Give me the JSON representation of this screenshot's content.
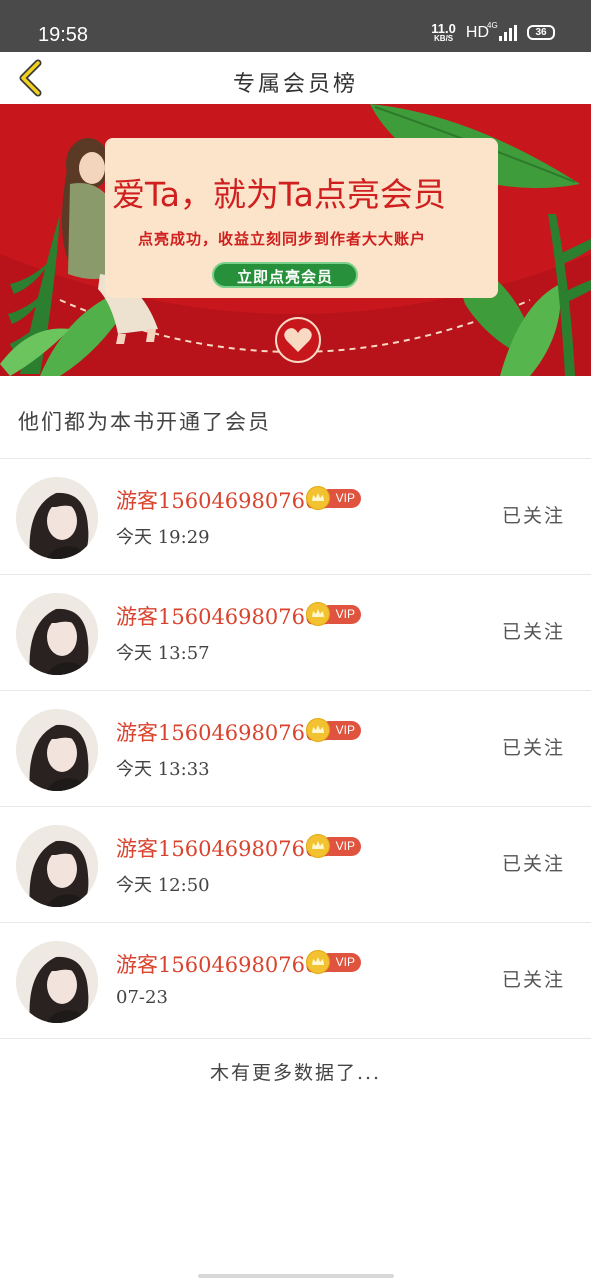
{
  "status_bar": {
    "time": "19:58",
    "net_speed": "11.0",
    "net_unit": "KB/S",
    "hd": "HD",
    "network": "4G",
    "battery": "36"
  },
  "nav": {
    "title": "专属会员榜"
  },
  "banner": {
    "headline": "爱Ta，就为Ta点亮会员",
    "subtitle": "点亮成功，收益立刻同步到作者大大账户",
    "button": "立即点亮会员"
  },
  "section_title": "他们都为本书开通了会员",
  "vip_label": "VIP",
  "members": [
    {
      "name": "游客1560469807668",
      "time": "今天 19:29",
      "status": "已关注"
    },
    {
      "name": "游客1560469807668",
      "time": "今天 13:57",
      "status": "已关注"
    },
    {
      "name": "游客1560469807668",
      "time": "今天 13:33",
      "status": "已关注"
    },
    {
      "name": "游客1560469807668",
      "time": "今天 12:50",
      "status": "已关注"
    },
    {
      "name": "游客1560469807668",
      "time": "07-23",
      "status": "已关注"
    }
  ],
  "footer": {
    "no_more": "木有更多数据了..."
  },
  "colors": {
    "banner_red": "#c8161d",
    "name_red": "#d9432d",
    "vip_red": "#e0533e",
    "button_green": "#26913a"
  }
}
